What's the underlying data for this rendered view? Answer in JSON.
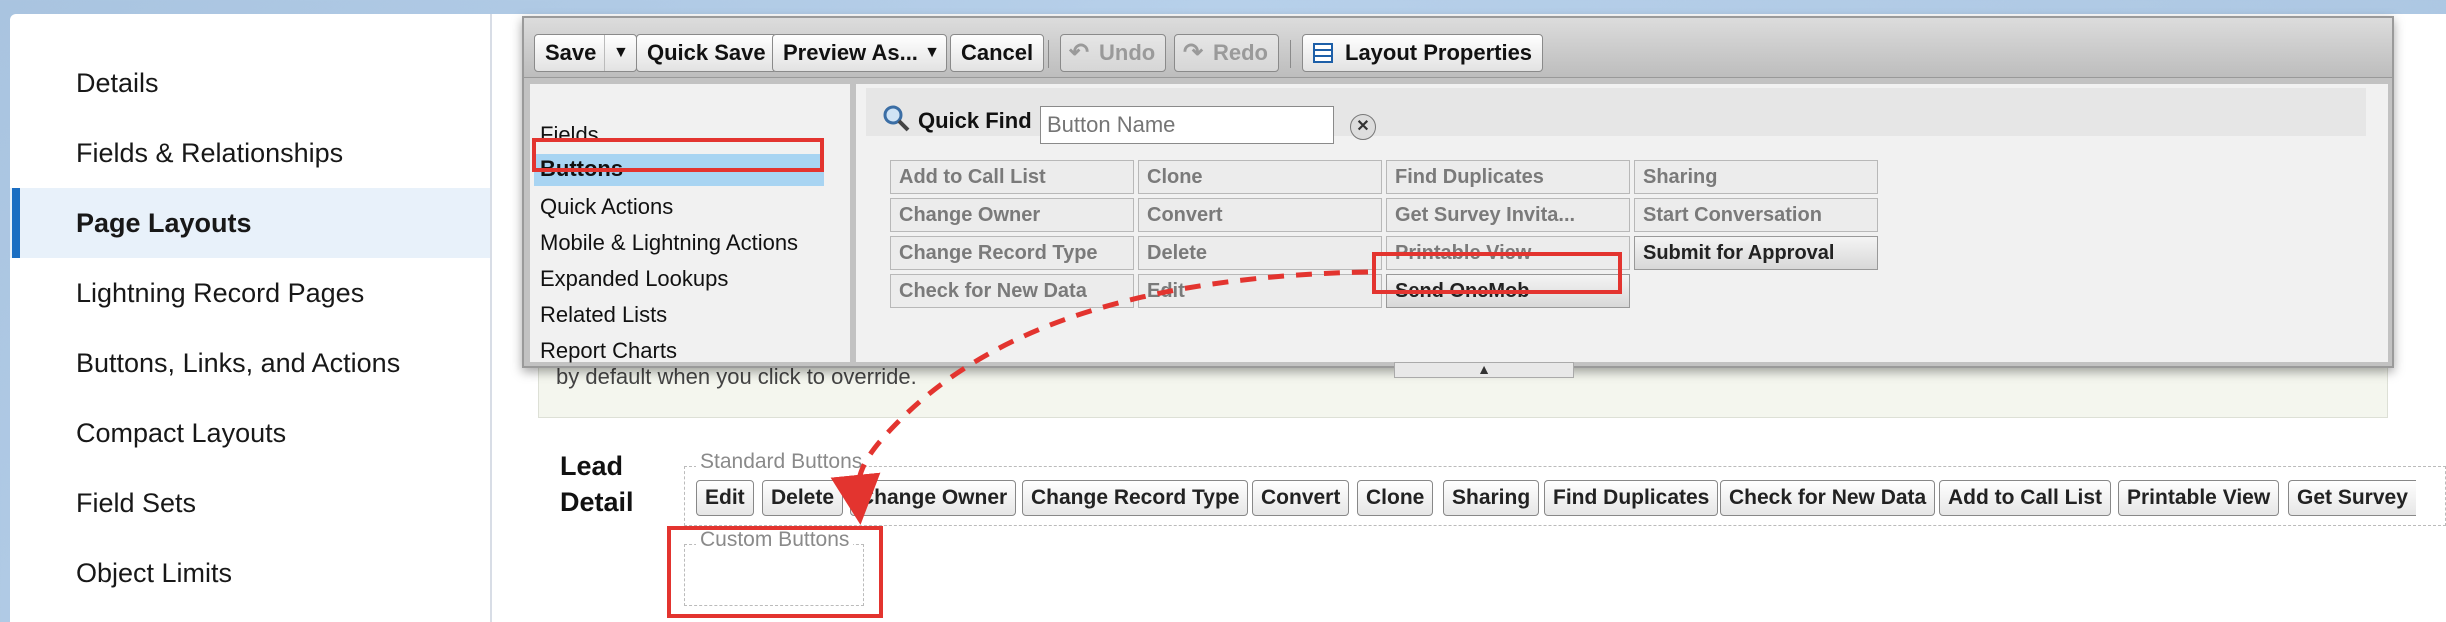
{
  "sidebar": {
    "items": [
      {
        "label": "Details"
      },
      {
        "label": "Fields & Relationships"
      },
      {
        "label": "Page Layouts",
        "active": true
      },
      {
        "label": "Lightning Record Pages"
      },
      {
        "label": "Buttons, Links, and Actions"
      },
      {
        "label": "Compact Layouts"
      },
      {
        "label": "Field Sets"
      },
      {
        "label": "Object Limits"
      }
    ]
  },
  "toolbar": {
    "save": "Save",
    "quick_save": "Quick Save",
    "preview_as": "Preview As...",
    "cancel": "Cancel",
    "undo": "Undo",
    "redo": "Redo",
    "layout_properties": "Layout Properties"
  },
  "palette": {
    "categories": [
      "Fields",
      "Buttons",
      "Quick Actions",
      "Mobile & Lightning Actions",
      "Expanded Lookups",
      "Related Lists",
      "Report Charts"
    ],
    "selected_category": "Buttons",
    "quick_find_label": "Quick Find",
    "quick_find_placeholder": "Button Name",
    "items": [
      [
        "Add to Call List",
        "Clone",
        "Find Duplicates",
        "Sharing"
      ],
      [
        "Change Owner",
        "Convert",
        "Get Survey Invita...",
        "Start Conversation"
      ],
      [
        "Change Record Type",
        "Delete",
        "Printable View",
        "Submit for Approval"
      ],
      [
        "Check for New Data",
        "Edit",
        "Send OneMob",
        ""
      ]
    ]
  },
  "layout": {
    "hint_text": "by default when you click to override.",
    "section_title_line1": "Lead",
    "section_title_line2": "Detail",
    "standard_buttons_legend": "Standard Buttons",
    "custom_buttons_legend": "Custom Buttons",
    "standard_buttons": [
      "Edit",
      "Delete",
      "Change Owner",
      "Change Record Type",
      "Convert",
      "Clone",
      "Sharing",
      "Find Duplicates",
      "Check for New Data",
      "Add to Call List",
      "Printable View",
      "Get Survey"
    ]
  },
  "colors": {
    "highlight": "#e3342f",
    "selected_category_bg": "#a8d4f2",
    "active_nav_bar": "#1b6ec2"
  }
}
